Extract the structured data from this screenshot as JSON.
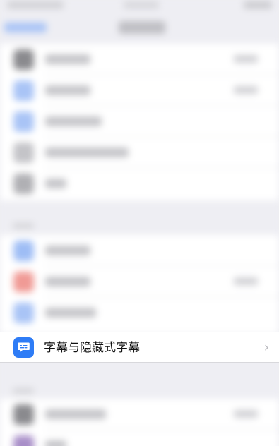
{
  "highlighted_row": {
    "label": "字幕与隐藏式字幕",
    "icon": "captions-bubble-icon",
    "chevron": "›",
    "icon_color": "#2e7cf6"
  },
  "blurred_background": {
    "icon_colors": [
      "#8a8a8e",
      "#a9c4f6",
      "#a9c4f6",
      "#c4c4c8",
      "#b0b0b4",
      "#9ebdf5",
      "#f09a95",
      "#a9c4f6",
      "#8a8a8e",
      "#a88ec8"
    ]
  }
}
